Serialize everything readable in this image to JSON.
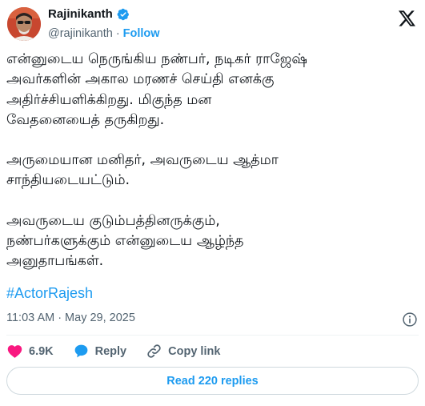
{
  "author": {
    "name": "Rajinikanth",
    "handle": "@rajinikanth",
    "separator": "·",
    "follow_label": "Follow",
    "verified": true,
    "accent_color": "#1d9bf0"
  },
  "logo_icon": "x-logo-icon",
  "tweet": {
    "paragraphs": [
      "என்னுடைய நெருங்கிய நண்பர், நடிகர் ராஜேஷ்\nஅவர்களின் அகால மரணச் செய்தி எனக்கு\nஅதிர்ச்சியளிக்கிறது. மிகுந்த மன\nவேதனையைத் தருகிறது.",
      "அருமையான மனிதர், அவருடைய ஆத்மா\nசாந்தியடையட்டும்.",
      "அவருடைய குடும்பத்தினருக்கும்,\nநண்பர்களுக்கும் என்னுடைய ஆழ்ந்த\nஅனுதாபங்கள்."
    ],
    "hashtag": "#ActorRajesh",
    "time": "11:03 AM",
    "dot": "·",
    "date": "May 29, 2025"
  },
  "actions": {
    "like_count": "6.9K",
    "reply_label": "Reply",
    "copy_label": "Copy link"
  },
  "read_replies_label": "Read 220 replies",
  "colors": {
    "like": "#f91880",
    "link": "#1d9bf0",
    "muted": "#536471",
    "text": "#0f1419"
  }
}
